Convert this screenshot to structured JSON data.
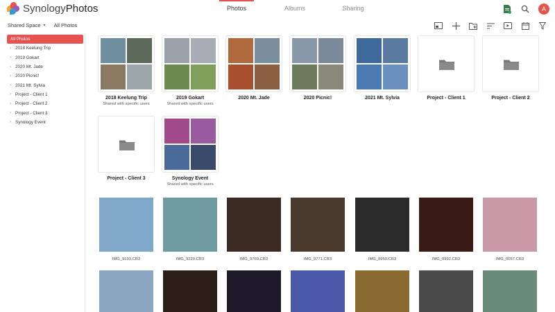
{
  "app": {
    "brand_a": "Synology",
    "brand_b": "Photos"
  },
  "tabs": [
    {
      "label": "Photos",
      "active": true
    },
    {
      "label": "Albums",
      "active": false
    },
    {
      "label": "Sharing",
      "active": false
    }
  ],
  "user": {
    "initial": "A"
  },
  "breadcrumb": {
    "space": "Shared Space",
    "current": "All Photos"
  },
  "sidebar": {
    "items": [
      {
        "label": "All Photos",
        "active": true
      },
      {
        "label": "2018 Keelung Trip"
      },
      {
        "label": "2019 Gokart"
      },
      {
        "label": "2020 Mt. Jade"
      },
      {
        "label": "2020 Picnic!"
      },
      {
        "label": "2021 Mt. Sylvia"
      },
      {
        "label": "Project - Client 1"
      },
      {
        "label": "Project - Client 2"
      },
      {
        "label": "Project - Client 3"
      },
      {
        "label": "Synology Event"
      }
    ]
  },
  "albums": [
    {
      "title": "2018 Keelung Trip",
      "subtitle": "Shared with specific users",
      "colors": [
        "#6f8f9f",
        "#5d6a5a",
        "#8a7a62",
        "#9aa6a8"
      ]
    },
    {
      "title": "2019 Gokart",
      "subtitle": "Shared with specific users",
      "colors": [
        "#9aa0a8",
        "#a8acb4",
        "#6b8a4f",
        "#7ea05a"
      ]
    },
    {
      "title": "2020 Mt. Jade",
      "subtitle": "",
      "colors": [
        "#b06a3e",
        "#7a8e9e",
        "#a94f2e",
        "#8a6040"
      ]
    },
    {
      "title": "2020 Picnic!",
      "subtitle": "",
      "colors": [
        "#8898a8",
        "#7a8a9a",
        "#6b7a5a",
        "#8a8a7a"
      ]
    },
    {
      "title": "2021 Mt. Sylvia",
      "subtitle": "",
      "colors": [
        "#3d6a9a",
        "#5a7aa0",
        "#4a7ab0",
        "#6a90c0"
      ]
    },
    {
      "title": "Project - Client 1",
      "subtitle": "",
      "folder": true
    },
    {
      "title": "Project - Client 2",
      "subtitle": "",
      "folder": true
    },
    {
      "title": "Project - Client 3",
      "subtitle": "",
      "folder": true
    },
    {
      "title": "Synology Event",
      "subtitle": "Shared with specific users",
      "colors": [
        "#a04a8a",
        "#9a5aa0",
        "#4a6a9a",
        "#3a4a6a"
      ]
    }
  ],
  "photos": [
    {
      "name": "IMG_9193.CR3",
      "color": "#7fa8c8"
    },
    {
      "name": "IMG_9220.CR3",
      "color": "#6f9aa0"
    },
    {
      "name": "IMG_9769.CR3",
      "color": "#3a2a22"
    },
    {
      "name": "IMG_9771.CR3",
      "color": "#4a3a2e"
    },
    {
      "name": "IMG_9950.CR3",
      "color": "#2a2a2a"
    },
    {
      "name": "IMG_9992.CR3",
      "color": "#3a1a14"
    },
    {
      "name": "IMG_0057.CR3",
      "color": "#c89aa8"
    }
  ],
  "photos_row2": [
    "#8aa6c0",
    "#2a1e16",
    "#1e1a2a",
    "#4a5aa8",
    "#8a6a30",
    "#4a4a4a",
    "#6a8a7a"
  ],
  "colors": {
    "accent": "#e5524f"
  }
}
